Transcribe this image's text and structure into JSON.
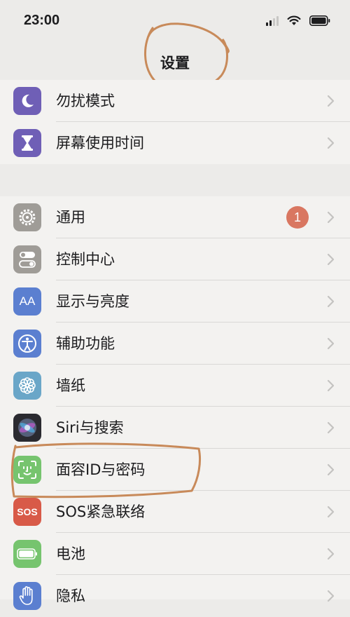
{
  "status": {
    "time": "23:00"
  },
  "nav": {
    "title": "设置"
  },
  "group1": [
    {
      "label": "勿扰模式",
      "icon": "moon-icon",
      "color": "#6f5fb6"
    },
    {
      "label": "屏幕使用时间",
      "icon": "hourglass-icon",
      "color": "#6f5fb6"
    }
  ],
  "group2": [
    {
      "label": "通用",
      "icon": "gear-icon",
      "color": "#9f9c97",
      "badge": "1"
    },
    {
      "label": "控制中心",
      "icon": "toggle-icon",
      "color": "#9f9c97"
    },
    {
      "label": "显示与亮度",
      "icon": "aa-icon",
      "color": "#5b7fd0",
      "icon_text": "AA"
    },
    {
      "label": "辅助功能",
      "icon": "accessibility-icon",
      "color": "#5b7fd0"
    },
    {
      "label": "墙纸",
      "icon": "flower-icon",
      "color": "#6aa6c8"
    },
    {
      "label": "Siri与搜索",
      "icon": "siri-icon",
      "color": "#2a2a30"
    },
    {
      "label": "面容ID与密码",
      "icon": "face-id-icon",
      "color": "#76c46e"
    },
    {
      "label": "SOS紧急联络",
      "icon": "sos-icon",
      "color": "#d85a48",
      "icon_text": "SOS"
    },
    {
      "label": "电池",
      "icon": "battery-icon",
      "color": "#76c46e"
    },
    {
      "label": "隐私",
      "icon": "hand-icon",
      "color": "#5b7fd0"
    }
  ],
  "colors": {
    "annotation": "#c88a5a",
    "badge": "#d97761"
  }
}
